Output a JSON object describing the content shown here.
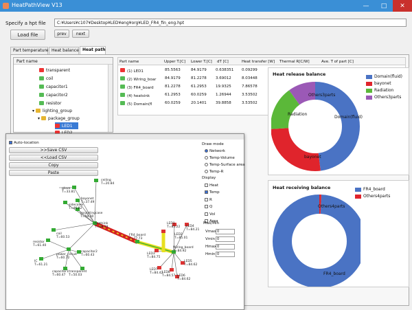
{
  "window": {
    "title": "HeatPathView V13"
  },
  "file": {
    "label": "Specify a hpt file",
    "path": "C:¥Users¥c107¥Desktop¥LED¥eng¥org¥LED_FR4_fin_eng.hpt",
    "load_button": "Load file",
    "prev_button": "prev",
    "next_button": "next"
  },
  "tabs": [
    "Part temperature",
    "Heat balance",
    "Heat path"
  ],
  "tree": {
    "header": "Part name",
    "items": [
      "transparent",
      "coil",
      "capacitor1",
      "capacitor2",
      "resistor",
      "lighting_group",
      "package_group",
      "LED1",
      "LED2"
    ]
  },
  "table": {
    "headers": [
      "Part name",
      "Upper T.[C]",
      "Lower T.[C]",
      "dT [C]",
      "Heat transfer [W]",
      "Thermal R[C/W]",
      "Ave. T of part [C]"
    ],
    "rows": [
      {
        "name": "(1) LED1",
        "upper": "85.5563",
        "lower": "84.9179",
        "dt": "0.638351",
        "ht": "0.09299"
      },
      {
        "name": "(2) Wiring_boar",
        "upper": "84.9179",
        "lower": "81.2278",
        "dt": "3.69012",
        "ht": "8.03448"
      },
      {
        "name": "(3) FR4_board",
        "upper": "81.2278",
        "lower": "61.2953",
        "dt": "19.9325",
        "ht": "7.86578"
      },
      {
        "name": "(4) heatsink",
        "upper": "61.2953",
        "lower": "60.0259",
        "dt": "1.26944",
        "ht": "3.53502"
      },
      {
        "name": "(5) Domain(fl",
        "upper": "60.0259",
        "lower": "20.1401",
        "dt": "39.8858",
        "ht": "3.53502"
      }
    ]
  },
  "colors": {
    "blue": "#4a73c4",
    "red": "#e0242c",
    "green": "#5bb839",
    "purple": "#9b59b6"
  },
  "release_chart": {
    "title": "Heat release balance",
    "legend": [
      "Domain(fluid)",
      "bayonet",
      "Radiation",
      "Others3parts"
    ],
    "labels": [
      "Domain(fluid)",
      "bayonet",
      "Radiation",
      "Others3parts"
    ]
  },
  "receiving_chart": {
    "title": "Heat receiving balance",
    "legend": [
      "FR4_board",
      "Others4parts"
    ],
    "labels": [
      "FR4_board",
      "Others4parts"
    ]
  },
  "chart_data": [
    {
      "type": "pie",
      "title": "Heat release balance",
      "categories": [
        "Domain(fluid)",
        "bayonet",
        "Radiation",
        "Others3parts"
      ],
      "values": [
        48,
        26,
        16,
        10
      ],
      "legend": "top-right"
    },
    {
      "type": "pie",
      "title": "Heat receiving balance",
      "categories": [
        "FR4_board",
        "Others4parts"
      ],
      "values": [
        99,
        1
      ],
      "legend": "top-right"
    }
  ],
  "path_window": {
    "auto_location": "Auto-location",
    "buttons": [
      ">>Save CSV",
      "<<Load CSV",
      "Copy",
      "Paste"
    ],
    "draw_mode": {
      "title": "Draw mode",
      "options": [
        "Network",
        "Temp-Volume",
        "Temp-Surface area",
        "Temp-R"
      ]
    },
    "display": {
      "title": "Display",
      "options": [
        "Heat",
        "Temp",
        "R",
        "Q",
        "Vol",
        "Area"
      ],
      "checked": [
        "Temp"
      ]
    },
    "maxmin": {
      "title": "Max/Min",
      "fields": [
        "Vmax",
        "Vmin",
        "Hmax",
        "Hmin"
      ],
      "values": [
        "0",
        "0",
        "0",
        "0"
      ]
    },
    "nodes": [
      {
        "name": "glove",
        "temp": "T=33.81"
      },
      {
        "name": "ceiling",
        "temp": "T=20.84"
      },
      {
        "name": "bayonet",
        "temp": "T=37.49"
      },
      {
        "name": "sidecover",
        "temp": "T=46.82"
      },
      {
        "name": "insulatingcase",
        "temp": "T=59.30"
      },
      {
        "name": "heatsink",
        "temp": "T=69.29"
      },
      {
        "name": "coil",
        "temp": "T=60.53"
      },
      {
        "name": "resistor",
        "temp": "T=61.40"
      },
      {
        "name": "power_circuit",
        "temp": "T=60.72"
      },
      {
        "name": "capacitor2",
        "temp": "T=60.43"
      },
      {
        "name": "IC",
        "temp": "T=61.21"
      },
      {
        "name": "capacitor1",
        "temp": "T=60.47"
      },
      {
        "name": "transparent",
        "temp": "T=50.03"
      },
      {
        "name": "FR4_board",
        "temp": "T=77.73"
      },
      {
        "name": "Wiring_board",
        "temp": "T=84.92"
      },
      {
        "name": "LED1",
        "temp": "T=85.22"
      },
      {
        "name": "LED2",
        "temp": "T=85.01"
      },
      {
        "name": "LED3",
        "temp": "T=84.75"
      },
      {
        "name": "LED4",
        "temp": "T=84.21"
      },
      {
        "name": "LED5",
        "temp": "T=84.62"
      },
      {
        "name": "LED6",
        "temp": "T=84.62"
      },
      {
        "name": "LED7",
        "temp": "T=84.42"
      },
      {
        "name": "LED8",
        "temp": "T=84.57"
      }
    ]
  }
}
